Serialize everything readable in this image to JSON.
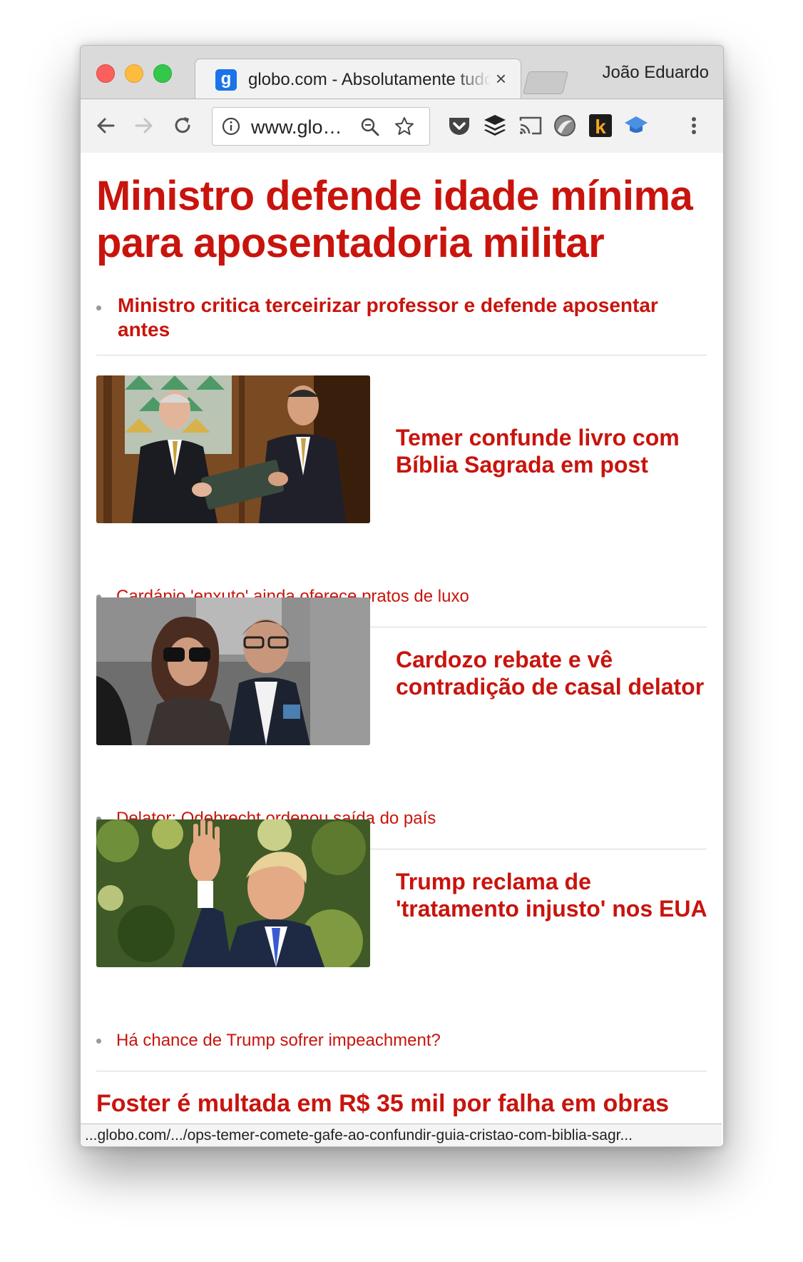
{
  "browser": {
    "tab_title": "globo.com - Absolutamente tudo sobre notícias, esportes e entretenimento",
    "tab_favicon_letter": "g",
    "tab_close_glyph": "×",
    "profile_name": "João Eduardo",
    "url_display": "www.globo.com",
    "status_url": "...globo.com/.../ops-temer-comete-gafe-ao-confundir-guia-cristao-com-biblia-sagr...",
    "icons": [
      "back-arrow-icon",
      "forward-arrow-icon",
      "reload-icon",
      "info-icon",
      "zoom-icon",
      "bookmark-star-icon",
      "pocket-icon",
      "buffer-icon",
      "cast-icon",
      "extension-globe-icon",
      "extension-k-icon",
      "extension-cap-icon",
      "menu-dots-icon"
    ]
  },
  "colors": {
    "accent_red": "#c8140d",
    "tab_bg": "#f2f2f2",
    "chrome_bg": "#dadada"
  },
  "page": {
    "headline": "Ministro defende idade mínima para aposentadoria militar",
    "headline_sub": "Ministro critica terceirizar professor e defende aposentar antes",
    "stories": [
      {
        "title": "Temer confunde livro com Bíblia Sagrada em post",
        "sub": "Cardápio 'enxuto' ainda oferece pratos de luxo"
      },
      {
        "title": "Cardozo rebate e vê contradição de casal delator",
        "sub": "Delator: Odebrecht ordenou saída do país"
      },
      {
        "title": "Trump reclama de 'tratamento injusto' nos EUA",
        "sub": "Há chance de Trump sofrer impeachment?"
      }
    ],
    "last_headline": "Foster é multada em R$ 35 mil por falha em obras"
  }
}
